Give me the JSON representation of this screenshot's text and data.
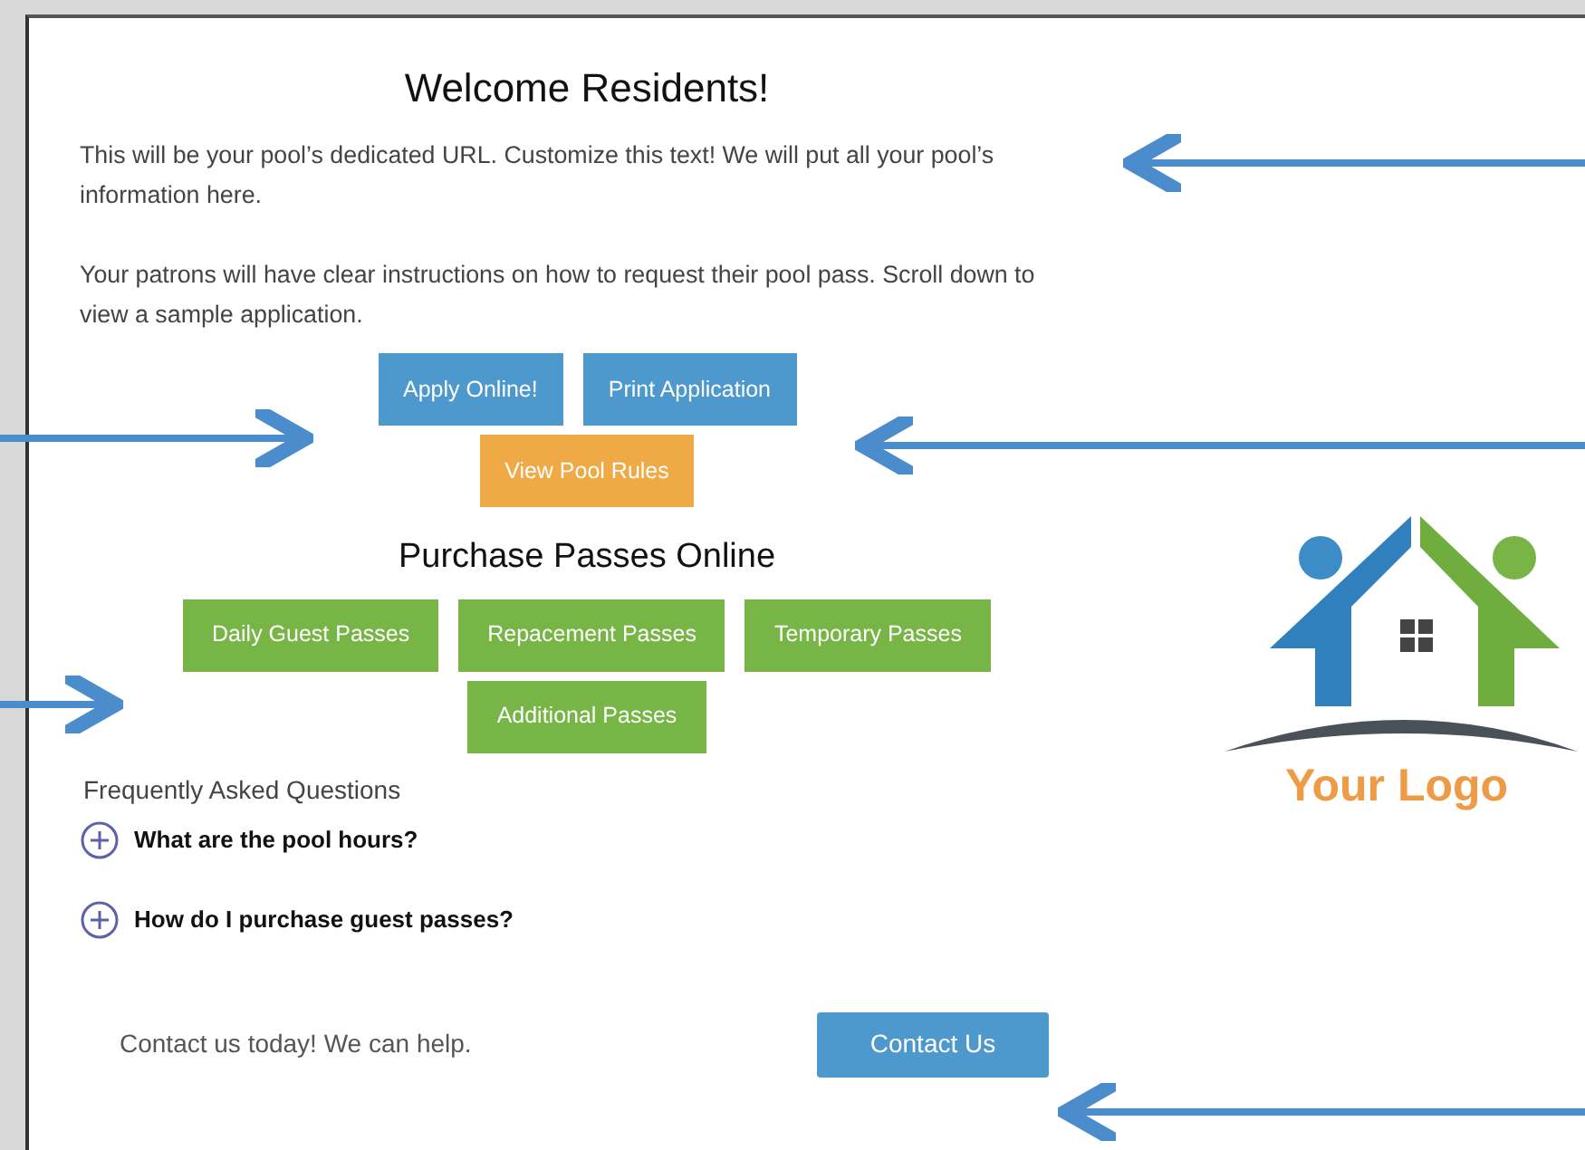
{
  "heading": "Welcome Residents!",
  "paragraphs": [
    "This will be your pool’s dedicated URL.  Customize this text!  We will put all your pool’s information here.",
    "Your patrons will have clear instructions on how to request their pool pass.  Scroll down to view a sample application."
  ],
  "action_buttons": [
    {
      "label": "Apply Online!",
      "kind": "blue"
    },
    {
      "label": "Print Application",
      "kind": "blue"
    },
    {
      "label": "View Pool Rules",
      "kind": "orange"
    }
  ],
  "passes": {
    "title": "Purchase Passes Online",
    "buttons": [
      "Daily Guest Passes",
      "Repacement Passes",
      "Temporary Passes",
      "Additional Passes"
    ]
  },
  "faq": {
    "title": "Frequently Asked Questions",
    "items": [
      {
        "question": "What are the pool hours?",
        "expanded": false
      },
      {
        "question": "How do I purchase guest passes?",
        "expanded": false
      }
    ]
  },
  "contact": {
    "text": "Contact us today! We can help.",
    "button": "Contact Us"
  },
  "logo": {
    "text": "Your Logo"
  }
}
